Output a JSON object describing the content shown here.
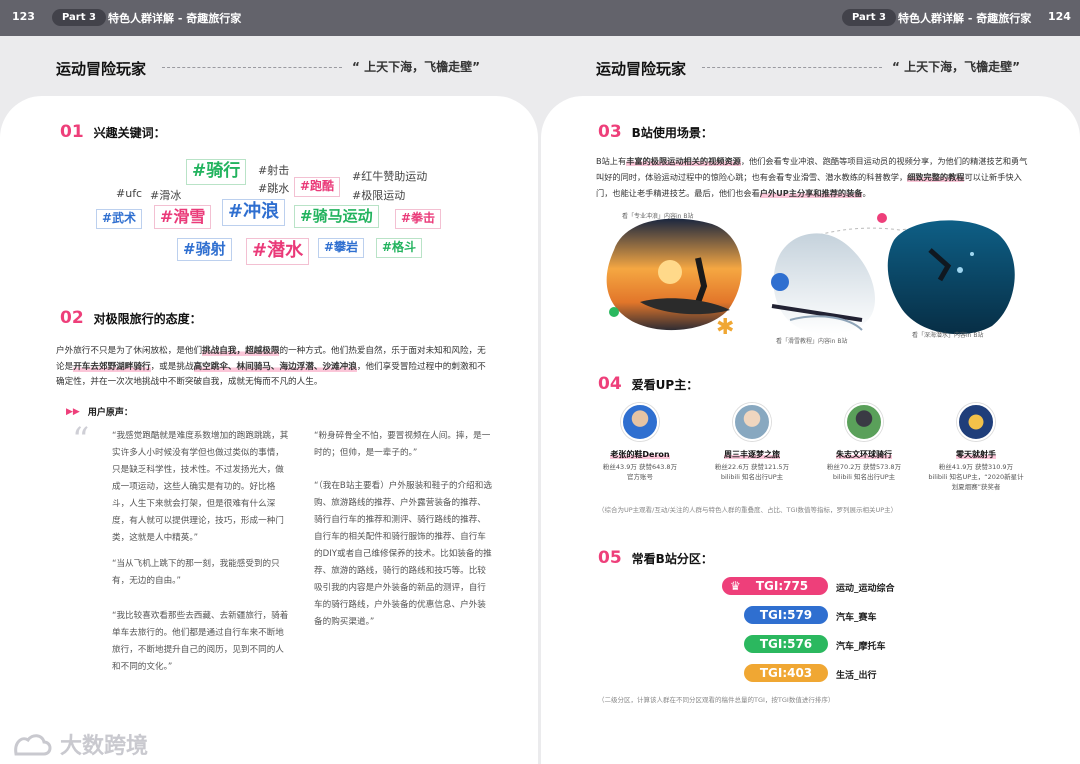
{
  "header": {
    "left_page": "123",
    "right_page": "124",
    "part": "Part 3",
    "crumb": "特色人群详解 - 奇趣旅行家"
  },
  "section": {
    "title": "运动冒险玩家",
    "quote": "“ 上天下海，飞檐走壁”"
  },
  "s01": {
    "num": "01",
    "title": "兴趣关键词："
  },
  "keywords": {
    "tagged": [
      {
        "text": "#骑行",
        "color": "green"
      },
      {
        "text": "#跑酷",
        "color": "pink"
      },
      {
        "text": "#武术",
        "color": "blue"
      },
      {
        "text": "#滑雪",
        "color": "pink"
      },
      {
        "text": "#冲浪",
        "color": "blue"
      },
      {
        "text": "#骑马运动",
        "color": "green"
      },
      {
        "text": "#拳击",
        "color": "pink"
      },
      {
        "text": "#骑射",
        "color": "blue"
      },
      {
        "text": "#潜水",
        "color": "pink"
      },
      {
        "text": "#攀岩",
        "color": "blue"
      },
      {
        "text": "#格斗",
        "color": "green"
      }
    ],
    "plain": [
      "#射击",
      "#红牛赞助运动",
      "#ufc",
      "#滑冰",
      "#跳水",
      "#极限运动"
    ]
  },
  "s02": {
    "num": "02",
    "title": "对极限旅行的态度："
  },
  "attitude": {
    "p1": "户外旅行不只是为了休闲放松，是他们",
    "h1": "挑战自我，超越极限",
    "p2": "的一种方式。他们热爱自然，乐于面对未知和风险，无论是",
    "h2": "开车去郊野湖畔骑行",
    "p3": "，或是挑战",
    "h3": "高空跳伞、林间骑马、海边浮潜、沙滩冲浪",
    "p4": "，他们享受冒险过程中的刺激和不确定性，并在一次次地挑战中不断突破自我，成就无悔而不凡的人生。"
  },
  "voice": {
    "label": "用户原声：",
    "left": [
      "“我感觉跑酷就是难度系数增加的跑跑跳跳，其实许多人小时候没有学但也做过类似的事情，只是缺乏科学性，技术性。不过发扬光大，做成一项运动，这些人确实是有功的。好比格斗，人生下来就会打架，但是很难有什么深度，有人就可以提供理论，技巧，形成一种门类，这就是人中精英。”",
      "“当从飞机上跳下的那一刻，我能感受到的只有，无边的自由。”",
      "“我比较喜欢看那些去西藏、去新疆旅行，骑着单车去旅行的。他们都是通过自行车来不断地旅行，不断地提升自己的阅历，见到不同的人和不同的文化。”"
    ],
    "right": [
      "“粉身碎骨全不怕，要冒视频在人间。摔，是一时的；但帅，是一辈子的。”",
      "“（我在B站主要看）户外服装和鞋子的介绍和选购、旅游路线的推荐、户外露营装备的推荐、骑行自行车的推荐和测评、骑行路线的推荐、自行车的相关配件和骑行服饰的推荐、自行车的DIY或者自己维修保养的技术。比如装备的推荐、旅游的路线，骑行的路线和技巧等。比较吸引我的内容是户外装备的新品的测评，自行车的骑行路线，户外装备的优惠信息、户外装备的购买渠道。”"
    ]
  },
  "s03": {
    "num": "03",
    "title": "B站使用场景："
  },
  "usage": {
    "p1": "B站上有",
    "h1": "丰富的极限运动相关的视频资源",
    "p2": "，他们会看专业冲浪、跑酷等项目运动员的视频分享，为他们的精湛技艺和勇气叫好的同时，体验运动过程中的惊险心跳；也有会看专业滑雪、潜水教练的科普教学，",
    "h2": "细致完整的教程",
    "p3": "可以让新手快入门，也能让老手精进技艺。最后，他们也会看",
    "h3": "户外UP主分享和推荐的装备",
    "p4": "。"
  },
  "photos": {
    "c1": "看「专业冲浪」内容in B站",
    "c2": "看「滑雪教程」内容in B站",
    "c3": "看「深海潜水」内容in B站"
  },
  "s04": {
    "num": "04",
    "title": "爱看UP主："
  },
  "ups": [
    {
      "name": "老张的鞋Deron",
      "stats": "粉丝43.9万 获赞643.8万",
      "desc": "官方账号"
    },
    {
      "name": "周三丰逐梦之旅",
      "stats": "粉丝22.6万 获赞121.5万",
      "desc": "bilibili 知名出行UP主"
    },
    {
      "name": "朱志文环球骑行",
      "stats": "粉丝70.2万 获赞573.8万",
      "desc": "bilibili 知名出行UP主"
    },
    {
      "name": "零天就射手",
      "stats": "粉丝41.9万 获赞310.9万",
      "desc": "bilibili 知名UP主，“2020新星计划夏烟赛”获奖者"
    }
  ],
  "up_note": "（综合为UP主观看/互动/关注的人群与特色人群的重叠度、占比、TGI数值等指标，罗列展示相关UP主）",
  "s05": {
    "num": "05",
    "title": "常看B站分区："
  },
  "tgi": [
    {
      "label": "TGI:775",
      "zone": "运动_运动综合",
      "color": "#ee3f7a",
      "crown": "♛"
    },
    {
      "label": "TGI:579",
      "zone": "汽车_赛车",
      "color": "#2f6fd0",
      "crown": ""
    },
    {
      "label": "TGI:576",
      "zone": "汽车_摩托车",
      "color": "#2bb85f",
      "crown": ""
    },
    {
      "label": "TGI:403",
      "zone": "生活_出行",
      "color": "#f0a733",
      "crown": ""
    }
  ],
  "tgi_note": "（二级分区，计算该人群在不同分区观看的稿件总量的TGI，按TGI数值进行排序）",
  "watermark": "大数跨境"
}
